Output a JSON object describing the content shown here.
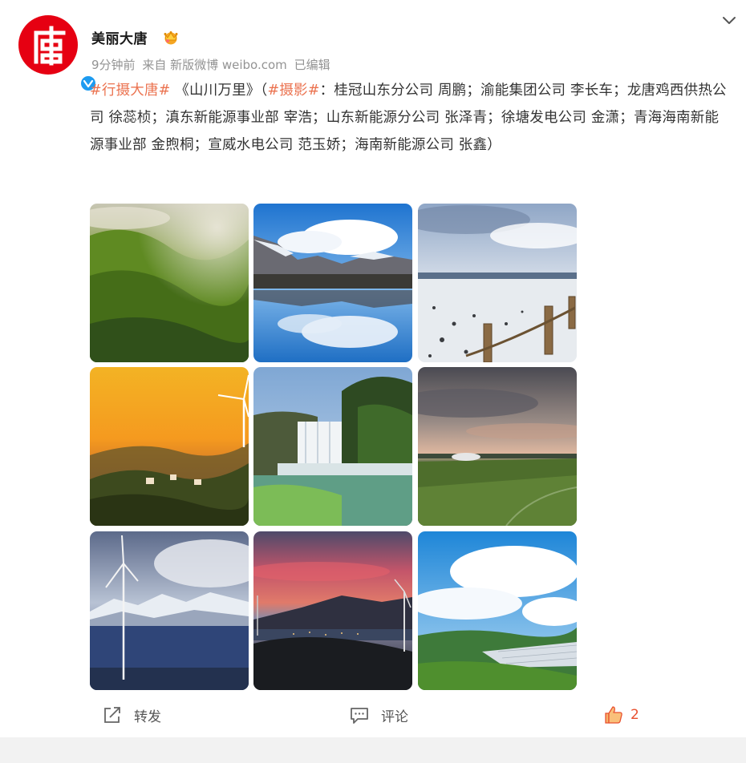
{
  "post": {
    "author": "美丽大唐",
    "meta": {
      "time": "9分钟前",
      "source": "来自 新版微博 weibo.com",
      "edited": "已编辑"
    },
    "text": {
      "tag1": "#行摄大唐#",
      "title": " 《山川万里》（",
      "tag2": "#摄影#",
      "body": "：桂冠山东分公司 周鹏；渝能集团公司 李长车；龙唐鸡西供热公司 徐蕊桢；滇东新能源事业部 宰浩；山东新能源分公司 张泽青；徐塘发电公司 金潇；青海海南新能源事业部 金煦桐；宣威水电公司 范玉娇；海南新能源公司 张鑫）"
    },
    "images": [
      {
        "scene": "forest-mist"
      },
      {
        "scene": "lake-reflection"
      },
      {
        "scene": "snowy-shore"
      },
      {
        "scene": "sunset-wind-turbine"
      },
      {
        "scene": "waterfall"
      },
      {
        "scene": "grassland-dusk"
      },
      {
        "scene": "wind-turbine-snow-mountains"
      },
      {
        "scene": "red-sky-turbines"
      },
      {
        "scene": "blue-sky-greenhouses"
      }
    ]
  },
  "actions": {
    "repost": "转发",
    "comment": "评论",
    "like_count": "2"
  },
  "colors": {
    "accent": "#eb7350",
    "brand": "#e60012",
    "verified": "#1d9bf0"
  }
}
